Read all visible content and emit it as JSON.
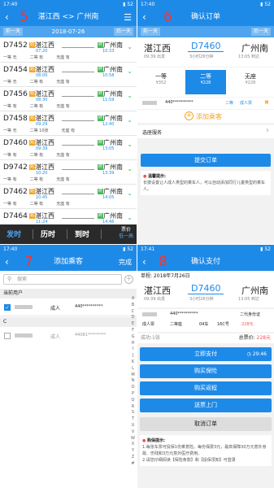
{
  "status": {
    "p5_time": "17:40",
    "p6_time": "17:40",
    "p7_time": "17:40",
    "p8_time": "17:41",
    "battery": "52"
  },
  "p5": {
    "step": "5",
    "title": "湛江西 <> 广州南",
    "date": "2018-07-26",
    "prev": "前一天",
    "next": "后一天",
    "trains": [
      {
        "num": "D7452",
        "from": "湛江西",
        "dep": "07:20",
        "to": "广州南",
        "arr": "10:33",
        "s1": "一等 无",
        "s2": "二等 有",
        "s3": "无座 有"
      },
      {
        "num": "D7454",
        "from": "湛江西",
        "dep": "08:00",
        "to": "广州南",
        "arr": "10:58",
        "s1": "一等 无",
        "s2": "二等 有",
        "s3": "无座 有"
      },
      {
        "num": "D7456",
        "from": "湛江西",
        "dep": "08:30",
        "to": "广州南",
        "arr": "11:59",
        "s1": "一等 有",
        "s2": "二等 有",
        "s3": "无座 有"
      },
      {
        "num": "D7458",
        "from": "湛江西",
        "dep": "09:29",
        "to": "广州南",
        "arr": "12:40",
        "s1": "一等 无",
        "s2": "二等 10张",
        "s3": "无座 有"
      },
      {
        "num": "D7460",
        "from": "湛江西",
        "dep": "09:39",
        "to": "广州南",
        "arr": "13:05",
        "s1": "一等 有",
        "s2": "二等 有",
        "s3": "无座 有"
      },
      {
        "num": "D9742",
        "from": "湛江西",
        "dep": "10:20",
        "to": "广州南",
        "arr": "13:39",
        "s1": "一等 有",
        "s2": "二等 有",
        "s3": "无座 有"
      },
      {
        "num": "D7462",
        "from": "湛江西",
        "dep": "10:45",
        "to": "广州南",
        "arr": "14:05",
        "s1": "一等 有",
        "s2": "二等 有",
        "s3": "无座 有"
      },
      {
        "num": "D7464",
        "from": "湛江西",
        "dep": "11:24",
        "to": "广州南",
        "arr": "14:46",
        "s1": "一等 有",
        "s2": "二等 有",
        "s3": "无座 有"
      }
    ],
    "tab_dep": "发时",
    "tab_dur": "历时",
    "tab_arr": "到时",
    "price_hi": "票价",
    "price_lo": "低一高"
  },
  "p6": {
    "step": "6",
    "title": "确认订单",
    "prev": "前一天",
    "next": "后一天",
    "from": "湛江西",
    "train": "D7460",
    "to": "广州南",
    "dep": "09:39 出发",
    "duration": "3小时26分钟",
    "arr": "13:05 到达",
    "seats": [
      {
        "name": "一等",
        "price": "¥352"
      },
      {
        "name": "二等",
        "price": "¥228"
      },
      {
        "name": "无座",
        "price": "¥228"
      }
    ],
    "passenger_id": "440**********",
    "seat_cls": "二等",
    "ptype": "成人票",
    "add_label": "添加乘客",
    "service_label": "选座服务",
    "submit": "提交订单",
    "notice_title": "温馨提示:",
    "notice_text": "长按设置让人成人类型的乘车人，可以自动添加同行儿童类型的乘车人。"
  },
  "p7": {
    "step": "7",
    "title": "添加乘客",
    "done": "完成",
    "search_placeholder": "搜索",
    "section1": "当前用户",
    "section2": "C",
    "ptype": "成人",
    "id1": "440**********",
    "id2": "44081*********",
    "alphabet": [
      "A",
      "B",
      "C",
      "D",
      "E",
      "F",
      "G",
      "H",
      "I",
      "J",
      "K",
      "L",
      "M",
      "N",
      "O",
      "P",
      "Q",
      "R",
      "S",
      "T",
      "U",
      "V",
      "W",
      "X",
      "Y",
      "Z",
      "#"
    ]
  },
  "p8": {
    "step": "8",
    "title": "确认支付",
    "date_label": "单程: 2018年7月26日",
    "from": "湛江西",
    "train": "D7460",
    "to": "广州南",
    "dep": "09:39 出发",
    "duration": "3小时26分钟",
    "arr": "13:05 到达",
    "passenger_id": "440**********",
    "id_type": "二代身份证",
    "ptype": "成人票",
    "seat_cls": "二等座",
    "car": "04车",
    "seat": "16C号",
    "price": "228元",
    "status": "成功:1张",
    "total_label": "总票价: ",
    "total": "228元",
    "pay": "立即支付",
    "timer": "29:46",
    "btn_ins": "购买保险",
    "btn_ret": "购买返程",
    "btn_door": "送票上门",
    "cancel": "取消订单",
    "notice_title": "购保提示:",
    "notice1": "1.每张车票可投保1份乘意险。每份保费3元，最高保障30万元意外身故、伤残和3万元意外医疗费用。",
    "notice2": "2.请您仔细阅读【保险条款】和【投保须知】可登录"
  }
}
